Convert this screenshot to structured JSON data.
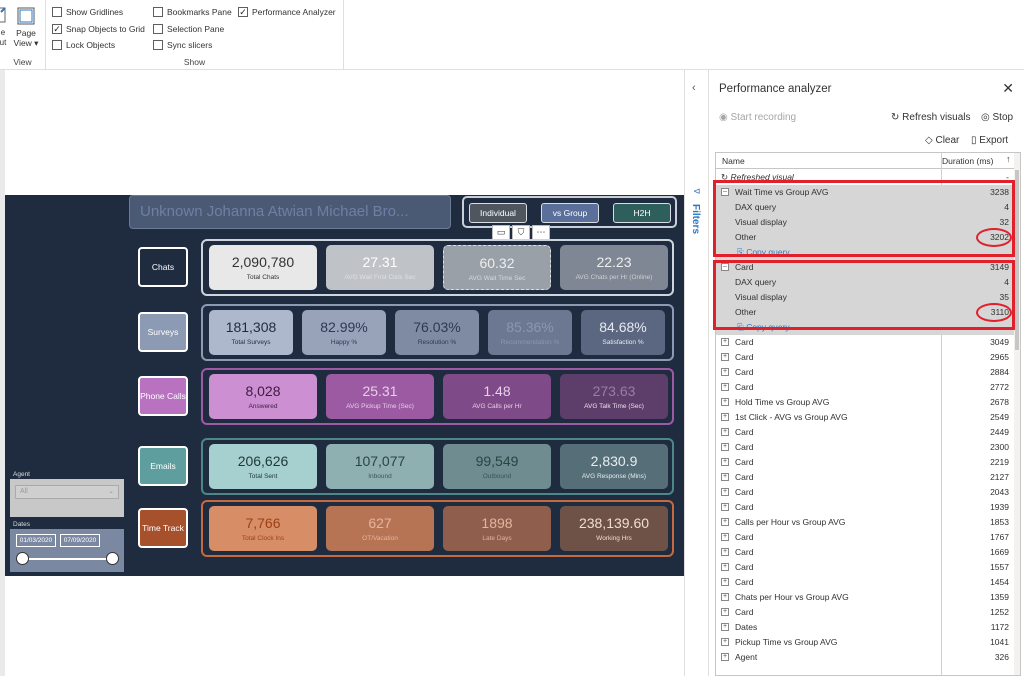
{
  "ribbon": {
    "view_group": {
      "btn1": "e\nut",
      "page_view": "Page\nView",
      "caption": "View"
    },
    "show_group": {
      "caption": "Show",
      "checks": [
        {
          "label": "Show Gridlines",
          "checked": false
        },
        {
          "label": "Snap Objects to Grid",
          "checked": true
        },
        {
          "label": "Lock Objects",
          "checked": false
        },
        {
          "label": "Bookmarks Pane",
          "checked": false
        },
        {
          "label": "Selection Pane",
          "checked": false
        },
        {
          "label": "Sync slicers",
          "checked": false
        },
        {
          "label": "Performance Analyzer",
          "checked": true
        }
      ]
    }
  },
  "report": {
    "title": "Unknown Johanna Atwian Michael Bro...",
    "nav": [
      "Individual",
      "vs Group",
      "H2H"
    ],
    "rows": [
      {
        "label": "Chats",
        "kpis": [
          {
            "value": "2,090,780",
            "label": "Total Chats"
          },
          {
            "value": "27.31",
            "label": "AVG Wait First Click Sec"
          },
          {
            "value": "60.32",
            "label": "AVG Wait Time Sec"
          },
          {
            "value": "22.23",
            "label": "AVG Chats per Hr (Online)"
          }
        ]
      },
      {
        "label": "Surveys",
        "kpis": [
          {
            "value": "181,308",
            "label": "Total Surveys"
          },
          {
            "value": "82.99%",
            "label": "Happy %"
          },
          {
            "value": "76.03%",
            "label": "Resolution %"
          },
          {
            "value": "85.36%",
            "label": "Recommendation %"
          },
          {
            "value": "84.68%",
            "label": "Satisfaction %"
          }
        ]
      },
      {
        "label": "Phone Calls",
        "kpis": [
          {
            "value": "8,028",
            "label": "Answered"
          },
          {
            "value": "25.31",
            "label": "AVG Pickup Time (Sec)"
          },
          {
            "value": "1.48",
            "label": "AVG Calls per Hr"
          },
          {
            "value": "273.63",
            "label": "AVG Talk Time (Sec)"
          }
        ]
      },
      {
        "label": "Emails",
        "kpis": [
          {
            "value": "206,626",
            "label": "Total Sent"
          },
          {
            "value": "107,077",
            "label": "Inbound"
          },
          {
            "value": "99,549",
            "label": "Outbound"
          },
          {
            "value": "2,830.9",
            "label": "AVG Response (Mins)"
          }
        ]
      },
      {
        "label": "Time Track",
        "kpis": [
          {
            "value": "7,766",
            "label": "Total Clock Ins"
          },
          {
            "value": "627",
            "label": "OT/Vacation"
          },
          {
            "value": "1898",
            "label": "Late Days"
          },
          {
            "value": "238,139.60",
            "label": "Working Hrs"
          }
        ]
      }
    ],
    "agent_slicer": {
      "header": "Agent",
      "value": "All"
    },
    "date_slicer": {
      "header": "Dates",
      "from": "01/03/2020",
      "to": "07/09/2020"
    }
  },
  "filters": {
    "label": "Filters"
  },
  "perf": {
    "title": "Performance analyzer",
    "start": "Start recording",
    "refresh": "Refresh visuals",
    "stop": "Stop",
    "clear": "Clear",
    "export": "Export",
    "col_name": "Name",
    "col_duration": "Duration (ms)",
    "rows": [
      {
        "name": "Refreshed visual",
        "dur": "-",
        "kind": "refresh"
      },
      {
        "name": "Wait Time vs Group AVG",
        "dur": "3238",
        "kind": "open"
      },
      {
        "name": "DAX query",
        "dur": "4",
        "kind": "child"
      },
      {
        "name": "Visual display",
        "dur": "32",
        "kind": "child"
      },
      {
        "name": "Other",
        "dur": "3202",
        "kind": "child"
      },
      {
        "name": "Copy query",
        "dur": "",
        "kind": "copy"
      },
      {
        "name": "Card",
        "dur": "3149",
        "kind": "open"
      },
      {
        "name": "DAX query",
        "dur": "4",
        "kind": "child"
      },
      {
        "name": "Visual display",
        "dur": "35",
        "kind": "child"
      },
      {
        "name": "Other",
        "dur": "3110",
        "kind": "child"
      },
      {
        "name": "Copy query",
        "dur": "",
        "kind": "copy"
      },
      {
        "name": "Card",
        "dur": "3049",
        "kind": "closed"
      },
      {
        "name": "Card",
        "dur": "2965",
        "kind": "closed"
      },
      {
        "name": "Card",
        "dur": "2884",
        "kind": "closed"
      },
      {
        "name": "Card",
        "dur": "2772",
        "kind": "closed"
      },
      {
        "name": "Hold Time vs Group AVG",
        "dur": "2678",
        "kind": "closed"
      },
      {
        "name": "1st Click - AVG vs Group AVG",
        "dur": "2549",
        "kind": "closed"
      },
      {
        "name": "Card",
        "dur": "2449",
        "kind": "closed"
      },
      {
        "name": "Card",
        "dur": "2300",
        "kind": "closed"
      },
      {
        "name": "Card",
        "dur": "2219",
        "kind": "closed"
      },
      {
        "name": "Card",
        "dur": "2127",
        "kind": "closed"
      },
      {
        "name": "Card",
        "dur": "2043",
        "kind": "closed"
      },
      {
        "name": "Card",
        "dur": "1939",
        "kind": "closed"
      },
      {
        "name": "Calls per Hour vs Group AVG",
        "dur": "1853",
        "kind": "closed"
      },
      {
        "name": "Card",
        "dur": "1767",
        "kind": "closed"
      },
      {
        "name": "Card",
        "dur": "1669",
        "kind": "closed"
      },
      {
        "name": "Card",
        "dur": "1557",
        "kind": "closed"
      },
      {
        "name": "Card",
        "dur": "1454",
        "kind": "closed"
      },
      {
        "name": "Chats per Hour vs Group AVG",
        "dur": "1359",
        "kind": "closed"
      },
      {
        "name": "Card",
        "dur": "1252",
        "kind": "closed"
      },
      {
        "name": "Dates",
        "dur": "1172",
        "kind": "closed"
      },
      {
        "name": "Pickup Time vs Group AVG",
        "dur": "1041",
        "kind": "closed"
      },
      {
        "name": "Agent",
        "dur": "326",
        "kind": "closed"
      }
    ]
  }
}
